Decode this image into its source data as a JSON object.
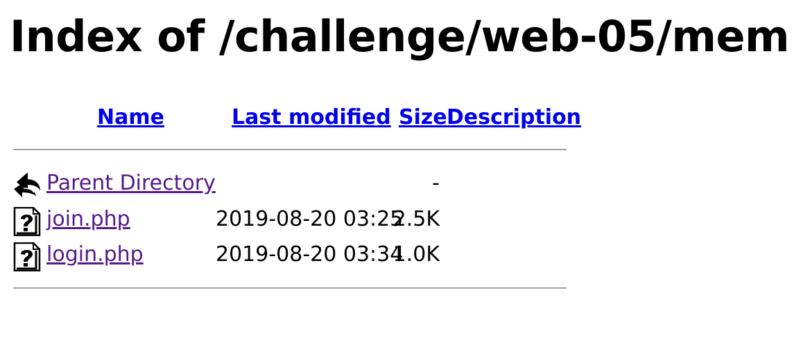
{
  "page": {
    "title": "Index of /challenge/web-05/mem"
  },
  "columns": {
    "name": "Name",
    "last_modified": "Last modified",
    "size": "Size",
    "description": "Description"
  },
  "entries": [
    {
      "name": "Parent Directory",
      "last_modified": "",
      "size": "-",
      "description": "",
      "icon": "back-arrow-icon"
    },
    {
      "name": "join.php",
      "last_modified": "2019-08-20 03:25",
      "size": "2.5K",
      "description": "",
      "icon": "unknown-file-icon"
    },
    {
      "name": "login.php",
      "last_modified": "2019-08-20 03:34",
      "size": "1.0K",
      "description": "",
      "icon": "unknown-file-icon"
    }
  ],
  "colors": {
    "link": "#0000ee",
    "visited_link": "#551a8b",
    "rule": "#a0a0a0"
  }
}
